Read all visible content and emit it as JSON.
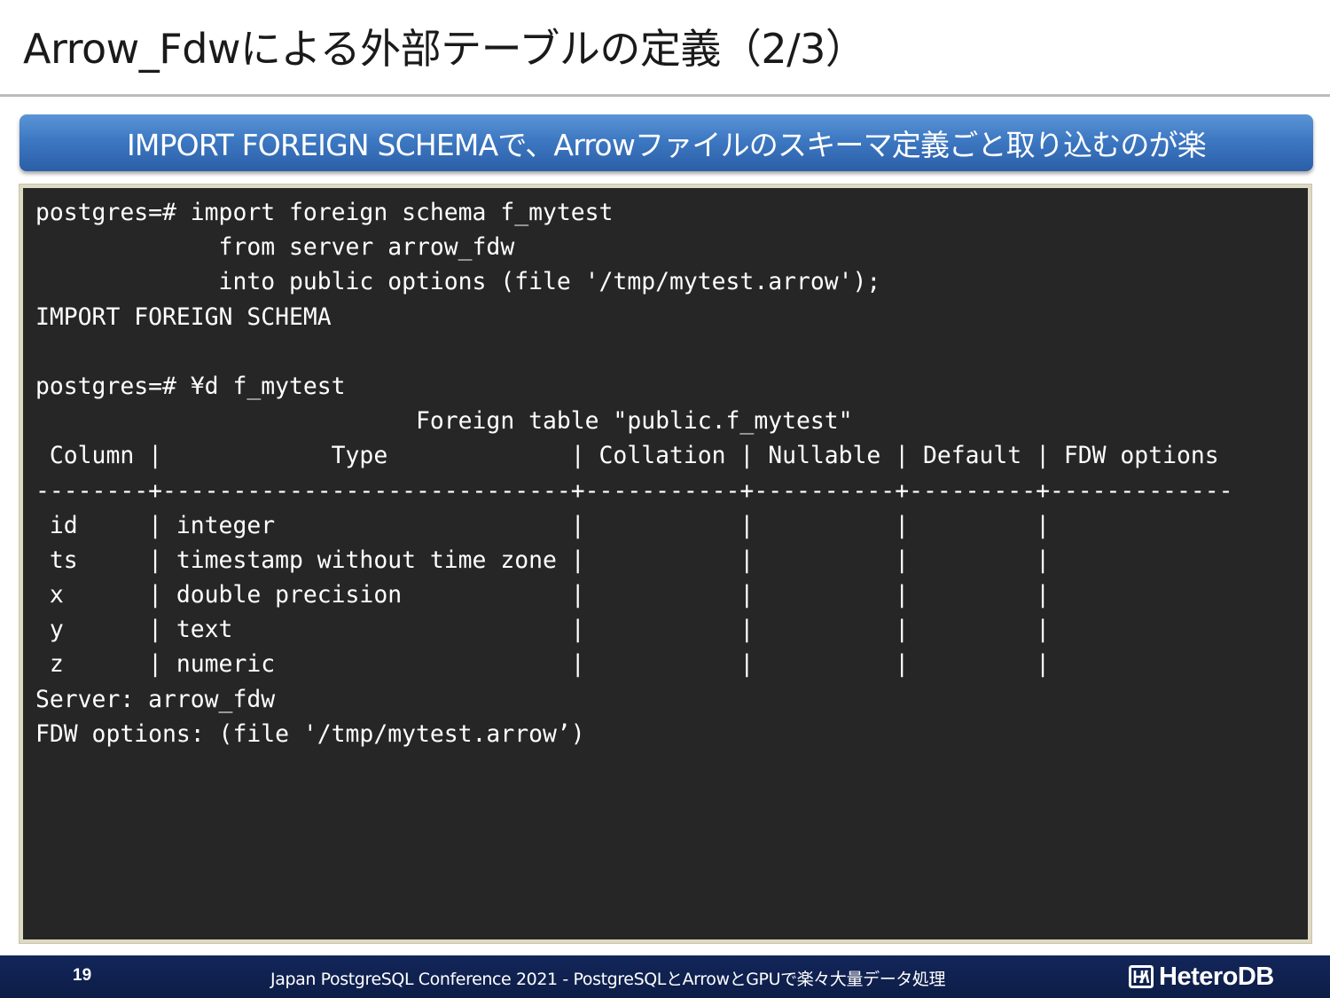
{
  "slide": {
    "title": "Arrow_Fdwによる外部テーブルの定義（2/3）",
    "banner": "IMPORT FOREIGN SCHEMAで、Arrowファイルのスキーマ定義ごと取り込むのが楽"
  },
  "terminal": {
    "lines": [
      "postgres=# import foreign schema f_mytest",
      "             from server arrow_fdw",
      "             into public options (file '/tmp/mytest.arrow');",
      "IMPORT FOREIGN SCHEMA",
      "",
      "postgres=# ¥d f_mytest",
      "                           Foreign table \"public.f_mytest\"",
      " Column |            Type             | Collation | Nullable | Default | FDW options",
      "--------+-----------------------------+-----------+----------+---------+-------------",
      " id     | integer                     |           |          |         |",
      " ts     | timestamp without time zone |           |          |         |",
      " x      | double precision            |           |          |         |",
      " y      | text                        |           |          |         |",
      " z      | numeric                     |           |          |         |",
      "Server: arrow_fdw",
      "FDW options: (file '/tmp/mytest.arrow’)"
    ]
  },
  "footer": {
    "page_number": "19",
    "conference": "Japan PostgreSQL Conference 2021 - PostgreSQLとArrowとGPUで楽々大量データ処理",
    "logo_text": "HeteroDB",
    "logo_icon": "heterodb-logo-icon"
  },
  "colors": {
    "banner": "#3d78c2",
    "terminal_bg": "#262626",
    "terminal_border": "#ddd9c3",
    "footer_bg": "#13265a"
  }
}
